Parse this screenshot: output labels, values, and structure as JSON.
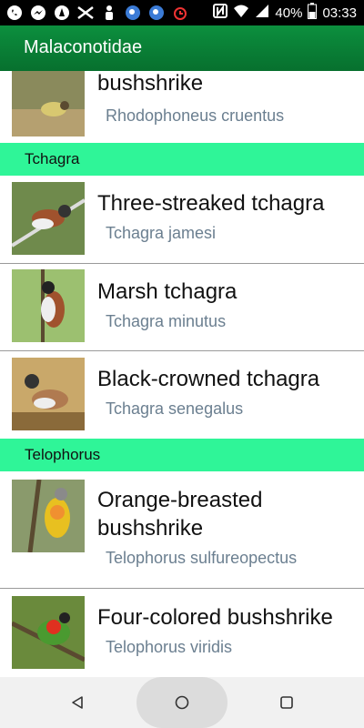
{
  "status": {
    "battery": "40%",
    "time": "03:33",
    "icons": [
      "whatsapp-icon",
      "messenger-icon",
      "alarm-icon",
      "usb-icon",
      "person-icon",
      "bird-icon",
      "bird-icon",
      "alarm-clock-icon",
      "nfc-icon",
      "wifi-icon",
      "signal-icon",
      "battery-icon"
    ]
  },
  "appbar": {
    "title": "Malaconotidae"
  },
  "list": {
    "partial": {
      "name": "bushshrike",
      "scientific": "Rhodophoneus cruentus"
    },
    "sections": [
      {
        "header": "Tchagra",
        "items": [
          {
            "name": "Three-streaked tchagra",
            "scientific": "Tchagra jamesi"
          },
          {
            "name": "Marsh tchagra",
            "scientific": "Tchagra minutus"
          },
          {
            "name": "Black-crowned tchagra",
            "scientific": "Tchagra senegalus"
          }
        ]
      },
      {
        "header": "Telophorus",
        "items": [
          {
            "name_line1": "Orange-breasted",
            "name_line2": "bushshrike",
            "scientific": "Telophorus sulfureopectus"
          },
          {
            "name": "Four-colored bushshrike",
            "scientific": "Telophorus viridis"
          }
        ]
      }
    ]
  },
  "colors": {
    "appbar": "#0c8f3e",
    "section_header": "#2ff598",
    "scientific_text": "#6b7f90"
  }
}
